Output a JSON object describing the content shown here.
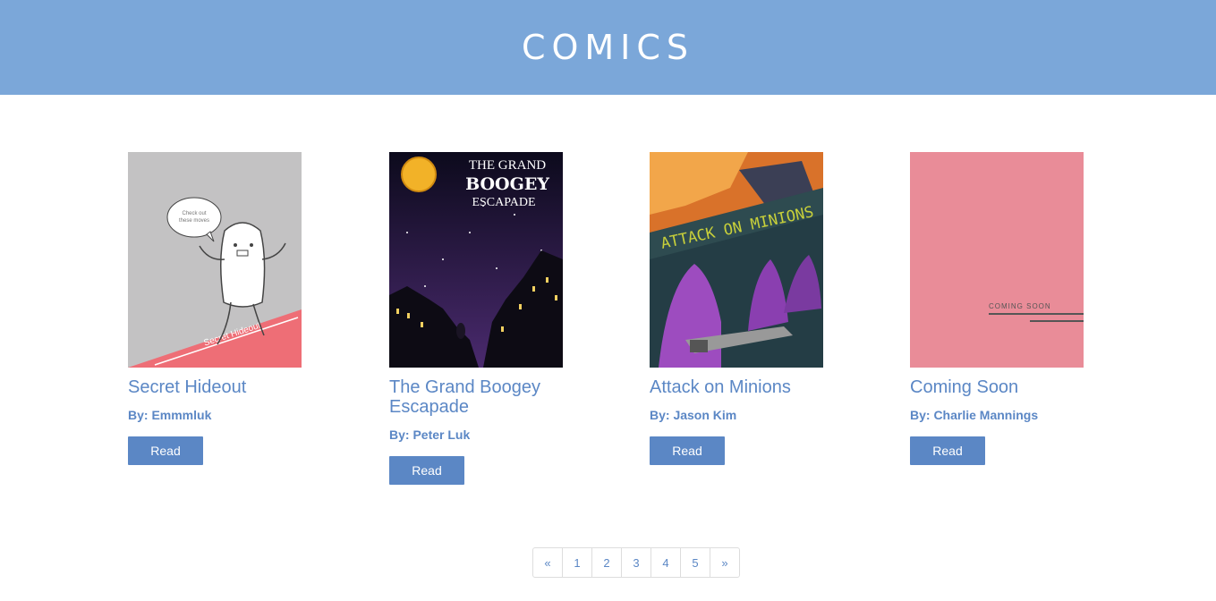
{
  "header": {
    "title": "COMICS"
  },
  "comics": [
    {
      "title": "Secret Hideout",
      "author": "By: Emmmluk",
      "button": "Read",
      "cover_text": [
        "Check out",
        "these moves",
        "Secret Hideout"
      ],
      "cover_bg": "#c3c2c3",
      "accent": "#ee6e76"
    },
    {
      "title": "The Grand Boogey Escapade",
      "author": "By: Peter Luk",
      "button": "Read",
      "cover_text": [
        "THE GRAND",
        "BOOGEY",
        "ESCAPADE"
      ],
      "cover_bg": "#2a1a3e",
      "accent": "#f2b228"
    },
    {
      "title": "Attack on Minions",
      "author": "By: Jason Kim",
      "button": "Read",
      "cover_text": [
        "ATTACK ON MINIONS"
      ],
      "cover_bg": "#243d45",
      "accent": "#9d4cbf"
    },
    {
      "title": "Coming Soon",
      "author": "By: Charlie Mannings",
      "button": "Read",
      "cover_text": [
        "COMING SOON"
      ],
      "cover_bg": "#e98c98",
      "accent": "#555555"
    }
  ],
  "pagination": {
    "prev": "«",
    "pages": [
      "1",
      "2",
      "3",
      "4",
      "5"
    ],
    "next": "»"
  },
  "colors": {
    "header_bg": "#7ba7d9",
    "link": "#5b87c5",
    "button_bg": "#5b87c5"
  }
}
